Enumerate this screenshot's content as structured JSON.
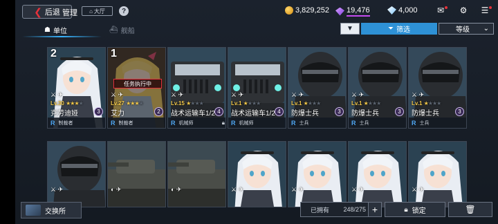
{
  "topbar": {
    "back_label": "后退",
    "title": "管理",
    "lobby_label": "大厅",
    "help_label": "?",
    "resources": {
      "gold": "3,829,252",
      "premium": "19,476",
      "diamonds": "4,000"
    }
  },
  "tabs": [
    {
      "label": "单位",
      "icon": "unit-icon"
    },
    {
      "label": "舰船",
      "icon": "ship-icon"
    }
  ],
  "controls": {
    "sort_symbol": "▼",
    "filter_label": "筛选",
    "level_label": "等级"
  },
  "cards": [
    {
      "count": "2",
      "level": "Lv.30",
      "stars": 3,
      "name": "克劳迪娅",
      "cost": "3",
      "rarity": "R",
      "role": "制裁者",
      "type": "girl",
      "dimmed": false,
      "mission": ""
    },
    {
      "count": "1",
      "level": "Lv.27",
      "stars": 3,
      "name": "艾力",
      "cost": "2",
      "rarity": "R",
      "role": "制裁者",
      "type": "blonde",
      "dimmed": true,
      "mission": "任务执行中"
    },
    {
      "count": "",
      "level": "Lv.15",
      "stars": 1,
      "name": "战术运输车1/2",
      "cost": "4",
      "rarity": "R",
      "role": "机械师",
      "type": "truck",
      "dimmed": false,
      "mission": "",
      "locked": true
    },
    {
      "count": "",
      "level": "Lv.1",
      "stars": 1,
      "name": "战术运输车1/2",
      "cost": "4",
      "rarity": "R",
      "role": "机械师",
      "type": "truck",
      "dimmed": false,
      "mission": ""
    },
    {
      "count": "",
      "level": "Lv.1",
      "stars": 1,
      "name": "防爆士兵",
      "cost": "3",
      "rarity": "R",
      "role": "士兵",
      "type": "soldier",
      "dimmed": false,
      "mission": ""
    },
    {
      "count": "",
      "level": "Lv.1",
      "stars": 1,
      "name": "防爆士兵",
      "cost": "3",
      "rarity": "R",
      "role": "士兵",
      "type": "soldier",
      "dimmed": false,
      "mission": ""
    },
    {
      "count": "",
      "level": "Lv.1",
      "stars": 1,
      "name": "防爆士兵",
      "cost": "3",
      "rarity": "R",
      "role": "士兵",
      "type": "soldier",
      "dimmed": false,
      "mission": ""
    },
    {
      "type": "soldier"
    },
    {
      "type": "tank"
    },
    {
      "type": "tank"
    },
    {
      "type": "girl"
    },
    {
      "type": "girl"
    },
    {
      "type": "girl"
    },
    {
      "type": "girl"
    }
  ],
  "bottom": {
    "exchange_label": "交换所",
    "owned_label": "已拥有",
    "owned_value": "248/275",
    "plus_label": "+",
    "lock_label": "锁定"
  },
  "colors": {
    "accent_blue": "#2e91d6",
    "alert_red": "#e5313a",
    "star_gold": "#f3c94a",
    "premium_purple": "#c54cf0"
  }
}
